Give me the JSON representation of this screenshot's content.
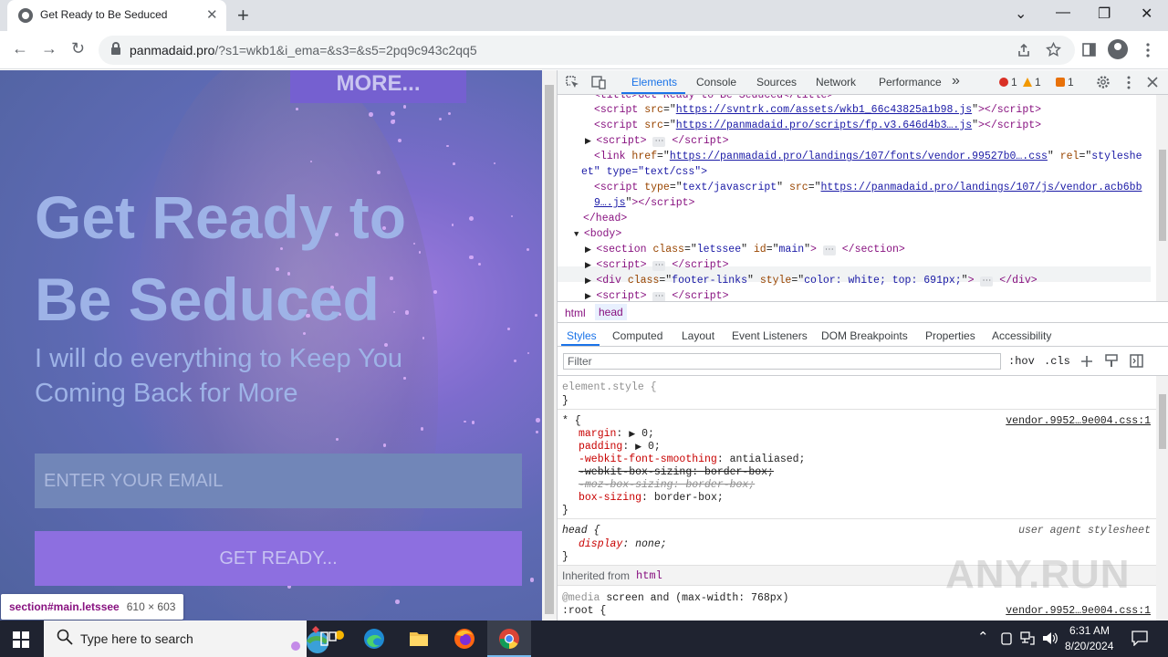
{
  "browser": {
    "tab_title": "Get Ready to Be Seduced",
    "close_glyph": "✕",
    "new_tab_glyph": "+",
    "url_host": "panmadaid.pro",
    "url_rest": "/?s1=wkb1&i_ema=&s3=&s5=2pq9c943c2qq5",
    "window_controls": [
      "⌄",
      "—",
      "❐",
      "✕"
    ],
    "nav": {
      "back": "←",
      "forward": "→",
      "reload": "↻"
    },
    "toolbar_icons": [
      "share-icon",
      "star-icon",
      "sidebar-icon",
      "profile-icon",
      "menu-icon"
    ]
  },
  "page": {
    "more_button": "MORE...",
    "title_line1": "Get Ready to",
    "title_line2": "Be Seduced",
    "subtitle": "I will do everything to Keep You Coming Back for More",
    "email_placeholder": "ENTER YOUR EMAIL",
    "cta_button": "GET READY...",
    "inspect_tooltip": {
      "selector": "section#main.letssee",
      "size": "610 × 603"
    }
  },
  "devtools": {
    "tabs": [
      "Elements",
      "Console",
      "Sources",
      "Network",
      "Performance"
    ],
    "more_tabs": "»",
    "errors": "1",
    "warnings": "1",
    "issues": "1",
    "dom_lines": {
      "l0": "<title>Get Ready to Be Seduced</title>",
      "l1_src": "https://svntrk.com/assets/wkb1_66c43825a1b98.js",
      "l2_src": "https://panmadaid.pro/scripts/fp.v3.646d4b3….js",
      "l4_href": "https://panmadaid.pro/landings/107/fonts/vendor.99527b0….css",
      "l4_rel": "styleshe",
      "l4b": "et\" type=\"text/css\">",
      "l5_src": "https://panmadaid.pro/landings/107/js/vendor.acb6bb",
      "l5b": "9….js",
      "head_close": "</head>",
      "body_open": "<body>",
      "section_class": "letssee",
      "section_id": "main",
      "footer_style": "color: white; top: 691px;"
    },
    "breadcrumb": [
      "html",
      "head"
    ],
    "subtabs": [
      "Styles",
      "Computed",
      "Layout",
      "Event Listeners",
      "DOM Breakpoints",
      "Properties",
      "Accessibility"
    ],
    "filter_placeholder": "Filter",
    "filter_tools": [
      ":hov",
      ".cls"
    ],
    "styles": {
      "element_style": "element.style {",
      "close": "}",
      "star_selector": "* {",
      "star_source": "vendor.9952…9e004.css:1",
      "margin": "margin",
      "margin_val": "0;",
      "padding": "padding",
      "padding_val": "0;",
      "font_smoothing": "-webkit-font-smoothing",
      "font_smoothing_val": "antialiased;",
      "webkit_box_sizing": "-webkit-box-sizing: border-box;",
      "moz_box_sizing": "-moz-box-sizing: border-box;",
      "box_sizing": "box-sizing",
      "box_sizing_val": "border-box;",
      "head_selector": "head {",
      "ua_source": "user agent stylesheet",
      "display": "display",
      "display_val": "none;",
      "inherited_label": "Inherited from",
      "inherited_tag": "html",
      "media": "@media",
      "media_query": "screen and (max-width: 768px)",
      "root_selector": ":root {",
      "root_source": "vendor.9952…9e004.css:1"
    }
  },
  "watermark": "ANY.RUN",
  "taskbar": {
    "search_text": "Type here to search",
    "search_icon": "🔍",
    "apps": [
      "task-view-icon",
      "edge-icon",
      "file-explorer-icon",
      "firefox-icon",
      "chrome-icon"
    ],
    "tray_chevron": "⌃",
    "time": "6:31 AM",
    "date": "8/20/2024"
  },
  "colors": {
    "page_accent": "#8d6fe0",
    "hero_text": "#9eb3e7",
    "devtools_blue": "#1a73e8",
    "tag_purple": "#881280"
  }
}
